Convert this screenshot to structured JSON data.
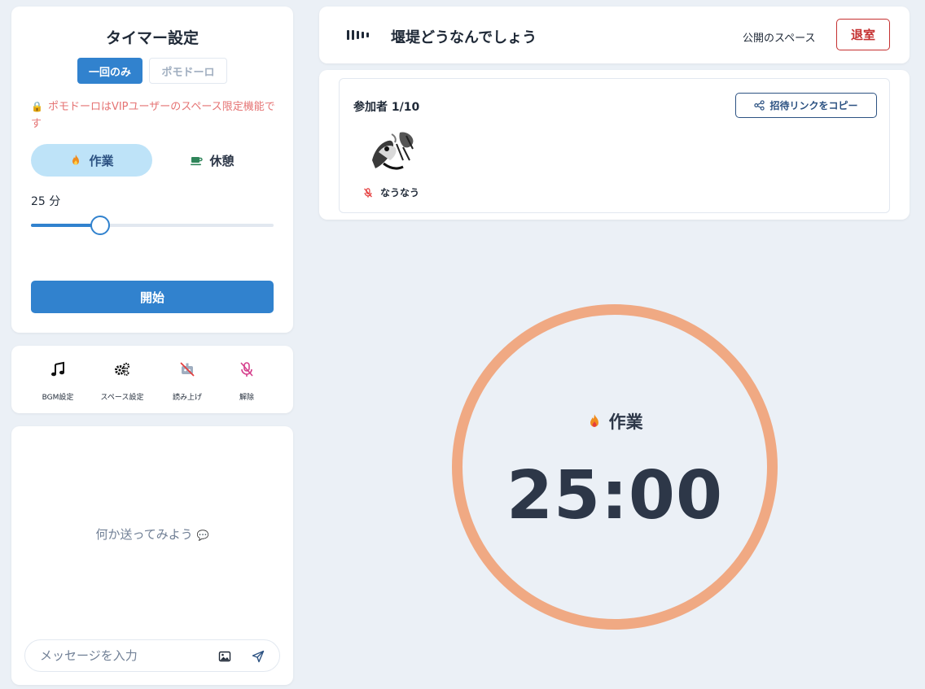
{
  "timer_settings": {
    "title": "タイマー設定",
    "mode_once": "一回のみ",
    "mode_pomodoro": "ポモドーロ",
    "vip_note": "ポモドーロはVIPユーザーのスペース限定機能です",
    "phase_work": "作業",
    "phase_break": "休憩",
    "minutes_label": "25 分",
    "slider_value_minutes": 25,
    "start_label": "開始"
  },
  "tools": {
    "bgm": "BGM設定",
    "space_settings": "スペース設定",
    "read_aloud": "読み上げ",
    "unmute": "解除"
  },
  "chat": {
    "empty_message": "何か送ってみよう",
    "input_placeholder": "メッセージを入力"
  },
  "header": {
    "space_title": "堰堤どうなんでしょう",
    "visibility": "公開のスペース",
    "leave_label": "退室"
  },
  "participants": {
    "count_label": "参加者 1/10",
    "invite_label": "招待リンクをコピー",
    "members": [
      {
        "name": "なうなう",
        "muted": true
      }
    ]
  },
  "timer": {
    "phase_label": "作業",
    "time": "25:00"
  },
  "colors": {
    "primary": "#3182ce",
    "danger": "#c53030",
    "ring": "#f0a983",
    "vip_note": "#e57373"
  }
}
